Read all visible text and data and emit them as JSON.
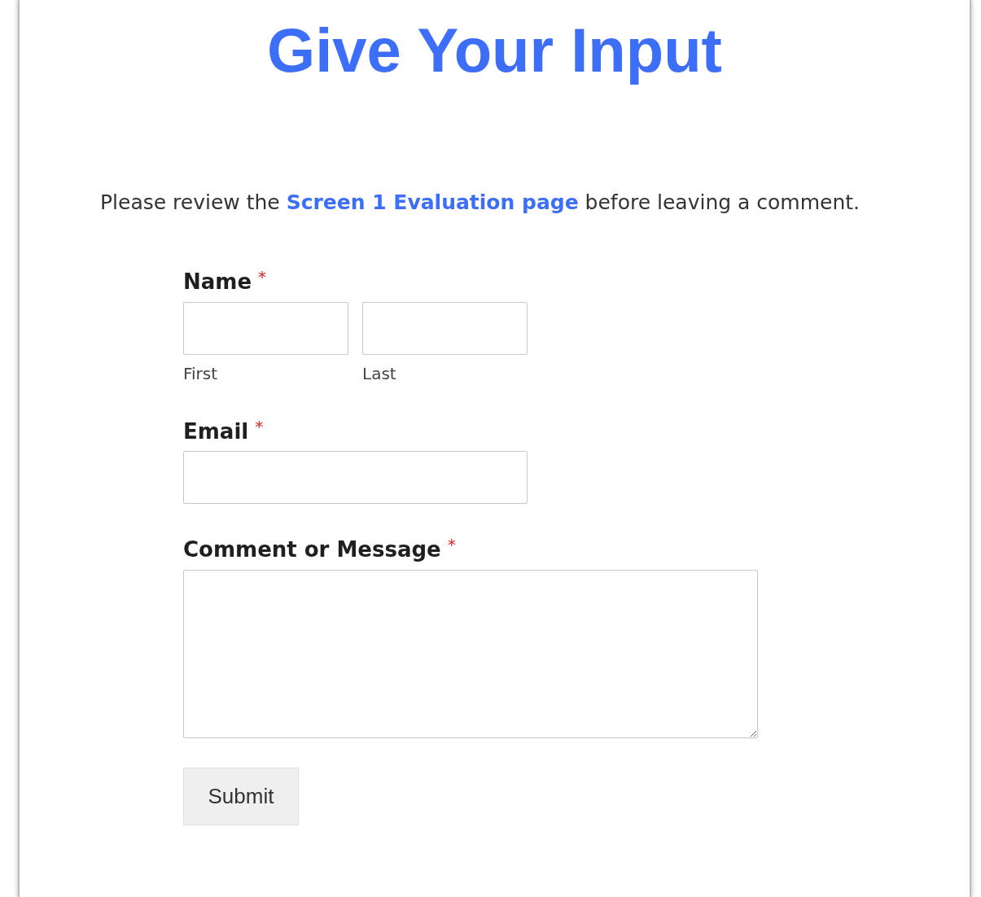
{
  "title": "Give Your Input",
  "intro": {
    "before": "Please review the ",
    "link": "Screen 1 Evaluation page",
    "after": " before leaving a comment."
  },
  "form": {
    "fields": [
      {
        "kind": "name",
        "label": "Name",
        "required_mark": "*",
        "parts": [
          {
            "sublabel": "First"
          },
          {
            "sublabel": "Last"
          }
        ]
      },
      {
        "kind": "email",
        "label": "Email",
        "required_mark": "*"
      },
      {
        "kind": "textarea",
        "label": "Comment or Message",
        "required_mark": "*"
      }
    ],
    "submit": "Submit"
  }
}
